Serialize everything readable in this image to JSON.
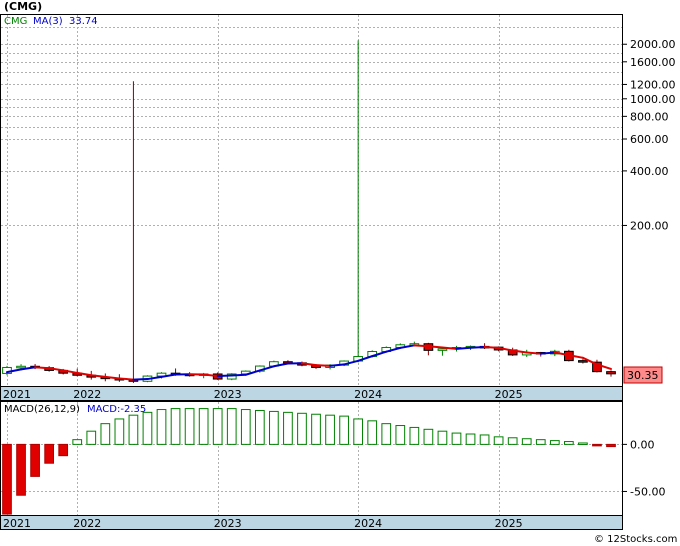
{
  "chart_data": [
    {
      "type": "candlestick",
      "title": "(CMG)",
      "legend": [
        {
          "label": "CMG",
          "color": "#008000"
        },
        {
          "label": "MA(3)",
          "color": "#0000cc"
        },
        {
          "label": "33.74",
          "color": "#0000cc"
        }
      ],
      "y_scale": "log",
      "ylim": [
        26,
        2900
      ],
      "y_ticks": [
        {
          "value": 2000,
          "label": "2000.00"
        },
        {
          "value": 1600,
          "label": "1600.00"
        },
        {
          "value": 1200,
          "label": "1200.00"
        },
        {
          "value": 1000,
          "label": "1000.00"
        },
        {
          "value": 800,
          "label": "800.00"
        },
        {
          "value": 600,
          "label": "600.00"
        },
        {
          "value": 400,
          "label": "400.00"
        },
        {
          "value": 200,
          "label": "200.00"
        }
      ],
      "y_gridlines": [
        2500,
        2000,
        1800,
        1600,
        1400,
        1200,
        1000,
        900,
        800,
        700,
        600,
        400,
        200
      ],
      "last_price": "30.35",
      "last_price_value": 30.35,
      "x_axis": [
        {
          "label": "2021",
          "index": 0
        },
        {
          "label": "2022",
          "index": 5
        },
        {
          "label": "2023",
          "index": 15
        },
        {
          "label": "2024",
          "index": 25
        },
        {
          "label": "2025",
          "index": 35
        }
      ],
      "x_count": 44,
      "series": [
        {
          "name": "CMG",
          "ohlc": [
            [
              30.5,
              33.6,
              29.8,
              32.9
            ],
            [
              32.9,
              34.3,
              32.1,
              33.4
            ],
            [
              33.4,
              34.4,
              32.2,
              32.8
            ],
            [
              32.8,
              33.5,
              31.2,
              31.7
            ],
            [
              31.7,
              32.3,
              30.1,
              30.6
            ],
            [
              30.6,
              32.4,
              29.4,
              29.8
            ],
            [
              29.8,
              31.5,
              28.2,
              29.1
            ],
            [
              29.1,
              30.5,
              27.6,
              28.6
            ],
            [
              28.6,
              30.2,
              27.4,
              28.2
            ],
            [
              28.2,
              1250,
              27.0,
              27.6
            ],
            [
              27.6,
              29.8,
              27.3,
              29.5
            ],
            [
              29.5,
              31.0,
              28.6,
              30.6
            ],
            [
              30.6,
              32.5,
              29.6,
              30.2
            ],
            [
              30.2,
              31.0,
              29.3,
              29.8
            ],
            [
              29.8,
              30.7,
              28.7,
              30.3
            ],
            [
              30.3,
              30.9,
              28.1,
              28.4
            ],
            [
              28.4,
              30.6,
              28.0,
              30.3
            ],
            [
              30.3,
              31.7,
              29.7,
              31.4
            ],
            [
              31.4,
              33.8,
              30.8,
              33.5
            ],
            [
              33.5,
              35.9,
              33.2,
              35.4
            ],
            [
              35.4,
              36.1,
              34.4,
              34.9
            ],
            [
              34.9,
              35.5,
              33.4,
              33.9
            ],
            [
              33.9,
              34.2,
              32.3,
              32.9
            ],
            [
              32.9,
              34.3,
              32.1,
              33.9
            ],
            [
              33.9,
              36.0,
              33.5,
              35.7
            ],
            [
              35.7,
              2100,
              35.1,
              37.8
            ],
            [
              37.8,
              40.9,
              37.4,
              40.3
            ],
            [
              40.3,
              43.0,
              39.8,
              42.4
            ],
            [
              42.4,
              44.7,
              41.9,
              43.9
            ],
            [
              43.9,
              45.7,
              43.0,
              44.5
            ],
            [
              44.5,
              45.0,
              38.4,
              40.9
            ],
            [
              40.9,
              42.3,
              38.2,
              41.7
            ],
            [
              41.7,
              43.3,
              40.3,
              42.4
            ],
            [
              42.4,
              43.5,
              41.1,
              43.0
            ],
            [
              43.0,
              44.8,
              41.6,
              42.6
            ],
            [
              42.6,
              43.0,
              40.4,
              41.1
            ],
            [
              41.1,
              42.3,
              38.1,
              38.6
            ],
            [
              38.6,
              41.2,
              37.6,
              39.8
            ],
            [
              39.8,
              40.1,
              37.8,
              39.1
            ],
            [
              39.1,
              41.2,
              38.0,
              40.4
            ],
            [
              40.4,
              41.2,
              35.5,
              35.9
            ],
            [
              35.9,
              36.6,
              34.6,
              35.2
            ],
            [
              35.2,
              36.3,
              30.9,
              31.2
            ],
            [
              31.2,
              31.7,
              29.3,
              30.35
            ]
          ]
        },
        {
          "name": "MA(3)",
          "values": [
            31.0,
            32.1,
            33.0,
            32.6,
            31.7,
            30.7,
            29.8,
            29.2,
            28.6,
            28.2,
            28.4,
            29.2,
            30.1,
            30.2,
            30.1,
            29.5,
            29.7,
            30.0,
            31.7,
            33.4,
            34.6,
            34.7,
            33.9,
            33.6,
            34.2,
            35.8,
            38.0,
            40.2,
            42.2,
            43.6,
            43.1,
            42.4,
            41.7,
            42.3,
            42.7,
            42.2,
            40.8,
            39.8,
            39.2,
            39.8,
            38.5,
            37.2,
            34.2,
            32.3
          ]
        }
      ]
    },
    {
      "type": "bar",
      "legend": [
        {
          "label": "MACD(26,12,9)",
          "color": "#000000"
        },
        {
          "label": "MACD:-2.35",
          "color": "#0000cc"
        }
      ],
      "ylim": [
        -75,
        45
      ],
      "y_ticks": [
        {
          "value": 0,
          "label": "0.00"
        },
        {
          "value": -50,
          "label": "-50.00"
        }
      ],
      "x_axis": [
        {
          "label": "2021",
          "index": 0
        },
        {
          "label": "2022",
          "index": 5
        },
        {
          "label": "2023",
          "index": 15
        },
        {
          "label": "2024",
          "index": 25
        },
        {
          "label": "2025",
          "index": 35
        }
      ],
      "series": [
        {
          "name": "MACD",
          "values": [
            -74,
            -54,
            -34,
            -20,
            -12,
            5,
            14,
            22,
            27,
            31,
            34,
            37,
            38,
            38,
            38,
            38,
            38,
            37,
            36,
            35,
            34,
            33,
            32,
            31,
            30,
            27,
            25,
            22,
            20,
            18,
            16,
            14,
            12,
            11,
            10,
            8,
            7,
            6,
            5,
            4,
            3,
            1.5,
            -0.8,
            -2.35
          ]
        }
      ]
    }
  ],
  "colors": {
    "up_candle": "#008000",
    "down_candle": "#e00000",
    "ma_up": "#0000cc",
    "ma_down": "#e00000",
    "axis_strip": "#bcd6e4",
    "last_price_box": "#ff8a8a"
  },
  "footer": {
    "watermark": "© 12Stocks.com"
  }
}
